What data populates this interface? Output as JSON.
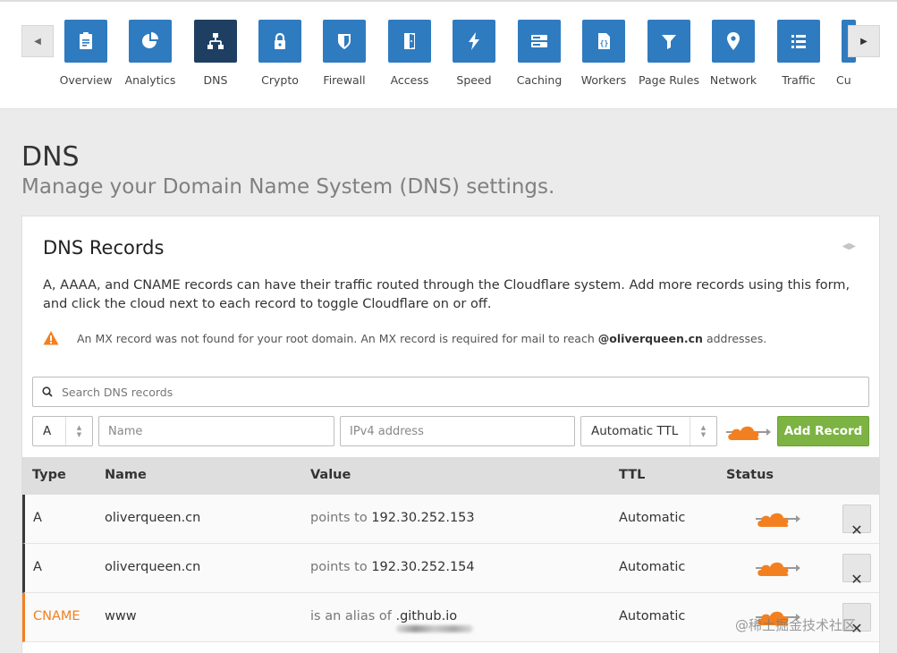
{
  "nav": {
    "items": [
      {
        "label": "Overview",
        "icon": "clipboard-icon",
        "active": false
      },
      {
        "label": "Analytics",
        "icon": "pie-chart-icon",
        "active": false
      },
      {
        "label": "DNS",
        "icon": "network-tree-icon",
        "active": true
      },
      {
        "label": "Crypto",
        "icon": "lock-icon",
        "active": false
      },
      {
        "label": "Firewall",
        "icon": "shield-icon",
        "active": false
      },
      {
        "label": "Access",
        "icon": "door-icon",
        "active": false
      },
      {
        "label": "Speed",
        "icon": "lightning-icon",
        "active": false
      },
      {
        "label": "Caching",
        "icon": "server-icon",
        "active": false
      },
      {
        "label": "Workers",
        "icon": "workers-icon",
        "active": false
      },
      {
        "label": "Page Rules",
        "icon": "filter-icon",
        "active": false
      },
      {
        "label": "Network",
        "icon": "location-pin-icon",
        "active": false
      },
      {
        "label": "Traffic",
        "icon": "list-icon",
        "active": false
      },
      {
        "label": "Cu",
        "icon": "partial-tile-icon",
        "active": false
      }
    ]
  },
  "page": {
    "title": "DNS",
    "subtitle": "Manage your Domain Name System (DNS) settings."
  },
  "card": {
    "title": "DNS Records",
    "description": "A, AAAA, and CNAME records can have their traffic routed through the Cloudflare system. Add more records using this form, and click the cloud next to each record to toggle Cloudflare on or off.",
    "warning_text": "An MX record was not found for your root domain. An MX record is required for mail to reach",
    "warning_domain": "@oliverqueen.cn",
    "warning_suffix": "addresses."
  },
  "search": {
    "placeholder": "Search DNS records"
  },
  "form": {
    "type_value": "A",
    "name_placeholder": "Name",
    "value_placeholder": "IPv4 address",
    "ttl_value": "Automatic TTL",
    "add_label": "Add Record"
  },
  "table": {
    "headers": {
      "type": "Type",
      "name": "Name",
      "value": "Value",
      "ttl": "TTL",
      "status": "Status"
    },
    "rows": [
      {
        "type": "A",
        "name": "oliverqueen.cn",
        "value_prefix": "points to",
        "value": "192.30.252.153",
        "ttl": "Automatic",
        "status": "proxied"
      },
      {
        "type": "A",
        "name": "oliverqueen.cn",
        "value_prefix": "points to",
        "value": "192.30.252.154",
        "ttl": "Automatic",
        "status": "proxied"
      },
      {
        "type": "CNAME",
        "name": "www",
        "value_prefix": "is an alias of",
        "value": ".github.io",
        "ttl": "Automatic",
        "status": "proxied"
      }
    ]
  },
  "watermark": "@稀土掘金技术社区",
  "colors": {
    "tile": "#2f7bbf",
    "tile_active": "#1e3f62",
    "cloud": "#f38020",
    "add_button": "#7cb342",
    "cname": "#f38020"
  }
}
